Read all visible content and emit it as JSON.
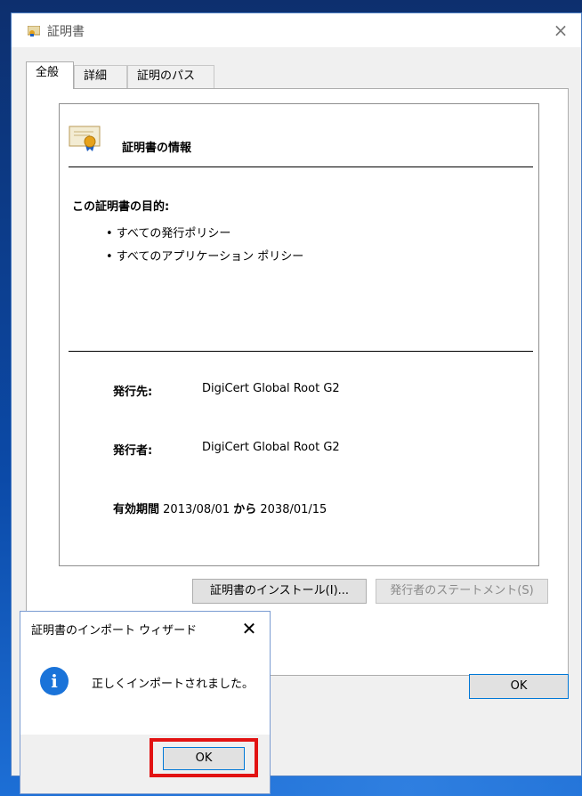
{
  "window": {
    "title": "証明書",
    "close_glyph": "×",
    "tabs": [
      {
        "label": "全般",
        "active": true
      },
      {
        "label": "詳細",
        "active": false
      },
      {
        "label": "証明のパス",
        "active": false
      }
    ]
  },
  "general": {
    "info_title": "証明書の情報",
    "purpose_title": "この証明書の目的:",
    "purposes": [
      "• すべての発行ポリシー",
      "• すべてのアプリケーション ポリシー"
    ],
    "issued_to_label": "発行先:",
    "issued_to_value": "DigiCert Global Root G2",
    "issued_by_label": "発行者:",
    "issued_by_value": "DigiCert Global Root G2",
    "validity_label": "有効期間",
    "valid_from": "2013/08/01",
    "validity_sep": "から",
    "valid_to": "2038/01/15"
  },
  "buttons": {
    "install": "証明書のインストール(I)...",
    "issuer_statement": "発行者のステートメント(S)",
    "ok": "OK"
  },
  "import_dialog": {
    "title": "証明書のインポート ウィザード",
    "close_glyph": "✕",
    "icon_glyph": "i",
    "message": "正しくインポートされました。",
    "ok": "OK"
  },
  "colors": {
    "accent": "#0078d7",
    "highlight": "#e21313",
    "info_icon": "#1a73d9"
  }
}
